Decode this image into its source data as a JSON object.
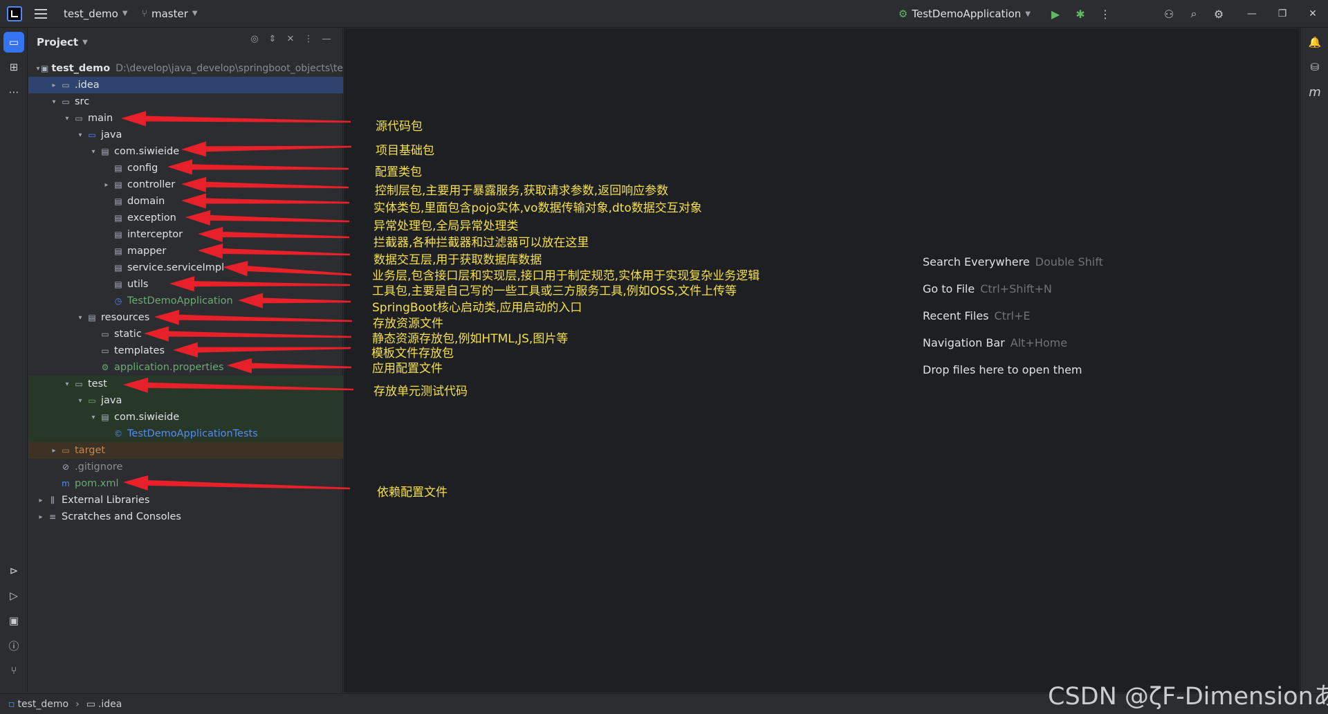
{
  "titlebar": {
    "project": "test_demo",
    "branch": "master",
    "run_config": "TestDemoApplication"
  },
  "project_panel": {
    "title": "Project",
    "tree": [
      {
        "label": "test_demo",
        "hint": "D:\\develop\\java_develop\\springboot_objects\\te",
        "icon": "module-icon",
        "color": "default"
      },
      {
        "label": ".idea",
        "icon": "folder-icon",
        "color": "default"
      },
      {
        "label": "src",
        "icon": "folder-icon",
        "color": "default"
      },
      {
        "label": "main",
        "icon": "folder-icon",
        "color": "default"
      },
      {
        "label": "java",
        "icon": "source-folder-icon",
        "color": "default"
      },
      {
        "label": "com.siwieide",
        "icon": "package-icon",
        "color": "default"
      },
      {
        "label": "config",
        "icon": "package-icon",
        "color": "default"
      },
      {
        "label": "controller",
        "icon": "package-icon",
        "color": "default"
      },
      {
        "label": "domain",
        "icon": "package-icon",
        "color": "default"
      },
      {
        "label": "exception",
        "icon": "package-icon",
        "color": "default"
      },
      {
        "label": "interceptor",
        "icon": "package-icon",
        "color": "default"
      },
      {
        "label": "mapper",
        "icon": "package-icon",
        "color": "default"
      },
      {
        "label": "service.serviceImpl",
        "icon": "package-icon",
        "color": "default"
      },
      {
        "label": "utils",
        "icon": "package-icon",
        "color": "default"
      },
      {
        "label": "TestDemoApplication",
        "icon": "spring-class-icon",
        "color": "#6aab73"
      },
      {
        "label": "resources",
        "icon": "resources-folder-icon",
        "color": "default"
      },
      {
        "label": "static",
        "icon": "folder-icon",
        "color": "default"
      },
      {
        "label": "templates",
        "icon": "folder-icon",
        "color": "default"
      },
      {
        "label": "application.properties",
        "icon": "properties-icon",
        "color": "#6aab73"
      },
      {
        "label": "test",
        "icon": "folder-icon",
        "color": "default"
      },
      {
        "label": "java",
        "icon": "test-folder-icon",
        "color": "default"
      },
      {
        "label": "com.siwieide",
        "icon": "package-icon",
        "color": "default"
      },
      {
        "label": "TestDemoApplicationTests",
        "icon": "class-icon",
        "color": "#548af7"
      },
      {
        "label": "target",
        "icon": "folder-icon",
        "color": "#c2884d"
      },
      {
        "label": ".gitignore",
        "icon": "gitignore-icon",
        "color": "#8b8e94"
      },
      {
        "label": "pom.xml",
        "icon": "maven-icon",
        "color": "#6aab73"
      },
      {
        "label": "External Libraries",
        "icon": "library-icon",
        "color": "default"
      },
      {
        "label": "Scratches and Consoles",
        "icon": "scratches-icon",
        "color": "default"
      }
    ]
  },
  "editor_hints": [
    {
      "action": "Search Everywhere",
      "shortcut": "Double Shift"
    },
    {
      "action": "Go to File",
      "shortcut": "Ctrl+Shift+N"
    },
    {
      "action": "Recent Files",
      "shortcut": "Ctrl+E"
    },
    {
      "action": "Navigation Bar",
      "shortcut": "Alt+Home"
    },
    {
      "action": "Drop files here to open them",
      "shortcut": ""
    }
  ],
  "annotations": [
    "源代码包",
    "项目基础包",
    "配置类包",
    "控制层包,主要用于暴露服务,获取请求参数,返回响应参数",
    "实体类包,里面包含pojo实体,vo数据传输对象,dto数据交互对象",
    "异常处理包,全局异常处理类",
    "拦截器,各种拦截器和过滤器可以放在这里",
    "数据交互层,用于获取数据库数据",
    "业务层,包含接口层和实现层,接口用于制定规范,实体用于实现复杂业务逻辑",
    "工具包,主要是自己写的一些工具或三方服务工具,例如OSS,文件上传等",
    "SpringBoot核心启动类,应用启动的入口",
    "存放资源文件",
    "静态资源存放包,例如HTML,JS,图片等",
    "模板文件存放包",
    "应用配置文件",
    "存放单元测试代码",
    "依赖配置文件"
  ],
  "statusbar": {
    "crumb1": "test_demo",
    "crumb2": ".idea"
  },
  "watermark": "CSDN @ζF-Dimensionあ",
  "colors": {
    "arrow": "#e8202a",
    "annotation_text": "#f4e04d",
    "selection": "#2e436e"
  }
}
